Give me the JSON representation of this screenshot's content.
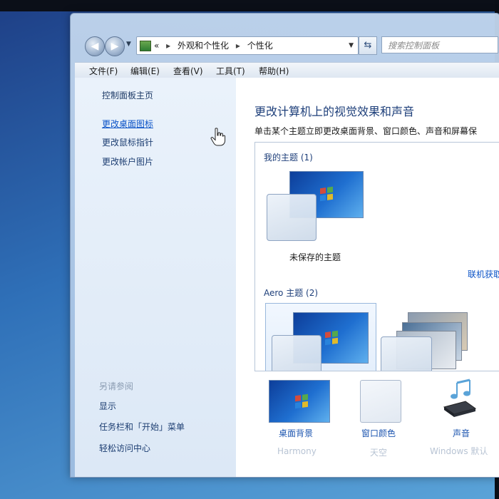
{
  "address_bar": {
    "chevrons": "«",
    "breadcrumbs": [
      "外观和个性化",
      "个性化"
    ],
    "search_placeholder": "搜索控制面板"
  },
  "menu": [
    "文件(F)",
    "编辑(E)",
    "查看(V)",
    "工具(T)",
    "帮助(H)"
  ],
  "left_pane": {
    "home": "控制面板主页",
    "links": [
      "更改桌面图标",
      "更改鼠标指针",
      "更改帐户图片"
    ],
    "see_also_heading": "另请参阅",
    "see_also": [
      "显示",
      "任务栏和「开始」菜单",
      "轻松访问中心"
    ]
  },
  "main": {
    "title": "更改计算机上的视觉效果和声音",
    "description": "单击某个主题立即更改桌面背景、窗口颜色、声音和屏幕保",
    "my_themes_label": "我的主题 (1)",
    "unsaved_theme": "未保存的主题",
    "online_link": "联机获取",
    "aero_label": "Aero 主题 (2)"
  },
  "bottom": [
    {
      "label": "桌面背景",
      "sub": "Harmony"
    },
    {
      "label": "窗口颜色",
      "sub": "天空"
    },
    {
      "label": "声音",
      "sub": "Windows 默认"
    }
  ],
  "colors": {
    "link": "#0b53c7",
    "title": "#1e3f7a",
    "desktop_blue": "#1f6fd0"
  }
}
